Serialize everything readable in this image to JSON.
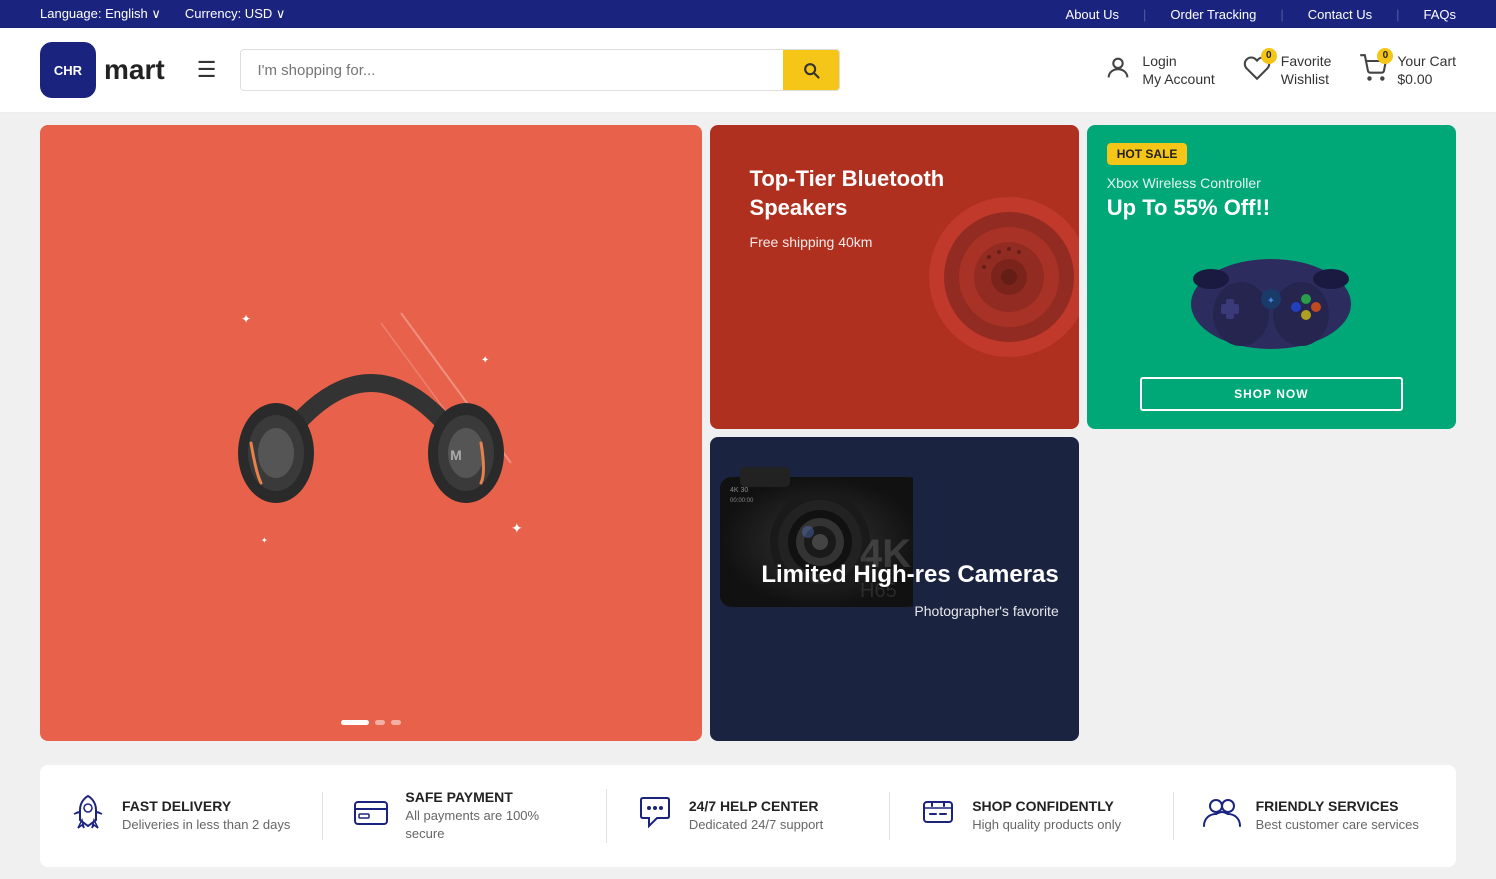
{
  "topbar": {
    "language_label": "Language: English",
    "language_dropdown": "∨",
    "currency_label": "Currency: USD",
    "currency_dropdown": "∨",
    "nav": [
      {
        "label": "About Us",
        "url": "#"
      },
      {
        "label": "Order Tracking",
        "url": "#"
      },
      {
        "label": "Contact Us",
        "url": "#"
      },
      {
        "label": "FAQs",
        "url": "#"
      }
    ]
  },
  "header": {
    "logo_text": "mart",
    "logo_abbr": "CHR",
    "search_placeholder": "I'm shopping for...",
    "account": {
      "top": "Login",
      "bottom": "My Account"
    },
    "wishlist": {
      "top": "Favorite",
      "bottom": "Wishlist",
      "count": "0"
    },
    "cart": {
      "top": "Your Cart",
      "bottom": "$0.00",
      "count": "0"
    }
  },
  "banners": {
    "hero": {
      "alt": "Gaming Headset"
    },
    "bluetooth": {
      "title": "Top-Tier Bluetooth Speakers",
      "subtitle": "Free shipping 40km"
    },
    "cameras": {
      "title": "Limited High-res Cameras",
      "subtitle": "Photographer's favorite"
    },
    "controller": {
      "badge": "HOT SALE",
      "title": "Xbox Wireless Controller",
      "discount": "Up To 55% Off!!",
      "btn": "SHOP NOW"
    }
  },
  "features": [
    {
      "icon": "rocket",
      "title": "FAST DELIVERY",
      "desc": "Deliveries in less than 2 days"
    },
    {
      "icon": "card",
      "title": "SAFE PAYMENT",
      "desc": "All payments are 100% secure"
    },
    {
      "icon": "chat",
      "title": "24/7 HELP CENTER",
      "desc": "Dedicated 24/7 support"
    },
    {
      "icon": "shield",
      "title": "SHOP CONFIDENTLY",
      "desc": "High quality products only"
    },
    {
      "icon": "people",
      "title": "FRIENDLY SERVICES",
      "desc": "Best customer care services"
    }
  ],
  "hero_dots": [
    "active",
    "inactive",
    "inactive"
  ]
}
